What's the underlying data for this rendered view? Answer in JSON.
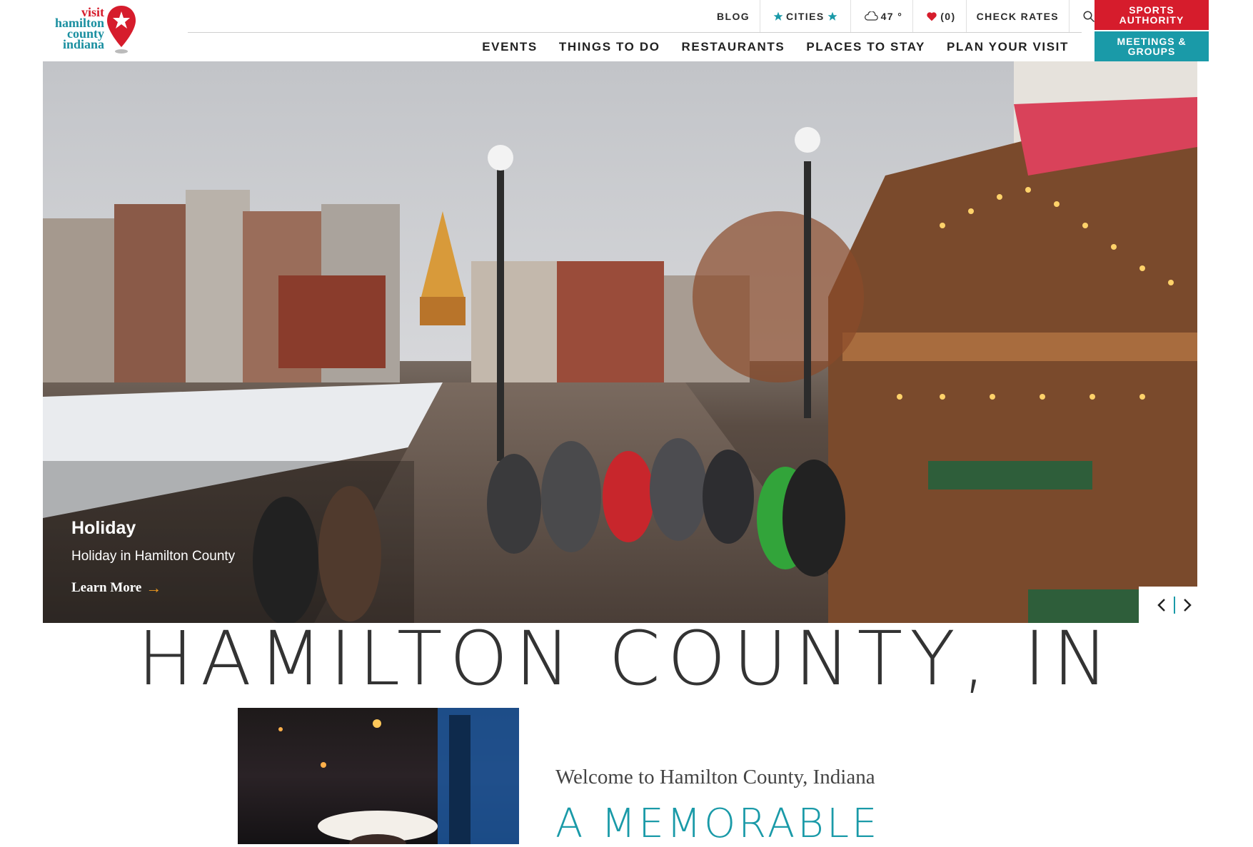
{
  "logo": {
    "line1": "visit",
    "line2": "hamilton",
    "line3": "county",
    "line4": "indiana"
  },
  "utility": {
    "blog": "BLOG",
    "cities": "CITIES",
    "weather": "47 °",
    "favorites": "(0)",
    "check_rates": "CHECK RATES"
  },
  "nav": {
    "events": "EVENTS",
    "things_to_do": "THINGS TO DO",
    "restaurants": "RESTAURANTS",
    "places_to_stay": "PLACES TO STAY",
    "plan_your_visit": "PLAN YOUR VISIT"
  },
  "buttons": {
    "sports_line1": "SPORTS",
    "sports_line2": "AUTHORITY",
    "meetings_line1": "MEETINGS &",
    "meetings_line2": "GROUPS"
  },
  "hero": {
    "category": "Holiday",
    "subtitle": "Holiday in Hamilton County",
    "link": "Learn More"
  },
  "headline": "HAMILTON COUNTY, IN",
  "intro": {
    "welcome": "Welcome to Hamilton County, Indiana",
    "tagline": "A MEMORABLE"
  },
  "colors": {
    "brand_red": "#d61c2c",
    "brand_teal": "#1a9aa8",
    "accent_orange": "#f29c1f"
  },
  "icons": [
    "search-icon",
    "star-icon",
    "cloud-icon",
    "heart-icon",
    "chevron-left-icon",
    "chevron-right-icon",
    "arrow-right-icon",
    "map-pin-icon"
  ]
}
